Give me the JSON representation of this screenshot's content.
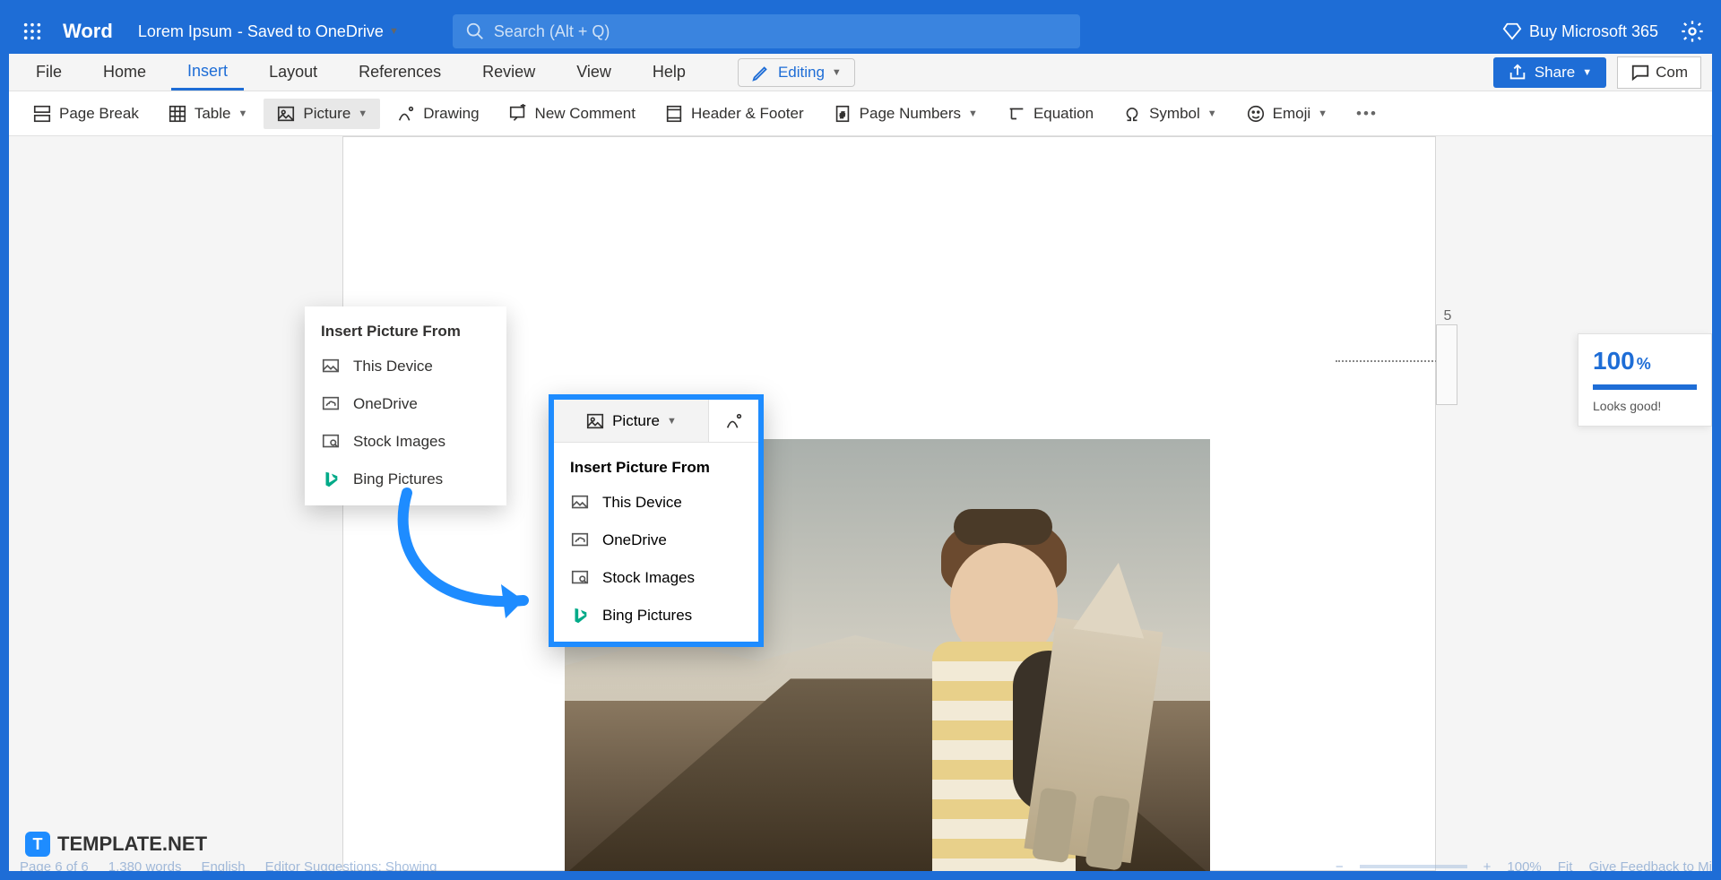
{
  "title": {
    "app": "Word",
    "doc": "Lorem Ipsum",
    "save": "- Saved to OneDrive",
    "search_placeholder": "Search (Alt + Q)",
    "buy": "Buy Microsoft 365"
  },
  "tabs": {
    "file": "File",
    "home": "Home",
    "insert": "Insert",
    "layout": "Layout",
    "references": "References",
    "review": "Review",
    "view": "View",
    "help": "Help",
    "editing": "Editing",
    "share": "Share",
    "com": "Com"
  },
  "ribbon": {
    "page_break": "Page Break",
    "table": "Table",
    "picture": "Picture",
    "drawing": "Drawing",
    "new_comment": "New Comment",
    "header_footer": "Header & Footer",
    "page_numbers": "Page Numbers",
    "equation": "Equation",
    "symbol": "Symbol",
    "emoji": "Emoji"
  },
  "dropdown": {
    "title": "Insert Picture From",
    "this_device": "This Device",
    "onedrive": "OneDrive",
    "stock_images": "Stock Images",
    "bing_pictures": "Bing Pictures"
  },
  "floating": {
    "picture": "Picture",
    "title": "Insert Picture From",
    "this_device": "This Device",
    "onedrive": "OneDrive",
    "stock_images": "Stock Images",
    "bing_pictures": "Bing Pictures"
  },
  "ruler": {
    "num": "5"
  },
  "panel": {
    "pct": "100",
    "pct_sym": "%",
    "msg": "Looks good!"
  },
  "status": {
    "page": "Page 6 of 6",
    "words": "1,380 words",
    "lang": "English",
    "editor": "Editor Suggestions: Showing",
    "zoom": "100%",
    "fit": "Fit",
    "feedback": "Give Feedback to Mi"
  },
  "watermark": "TEMPLATE.NET"
}
